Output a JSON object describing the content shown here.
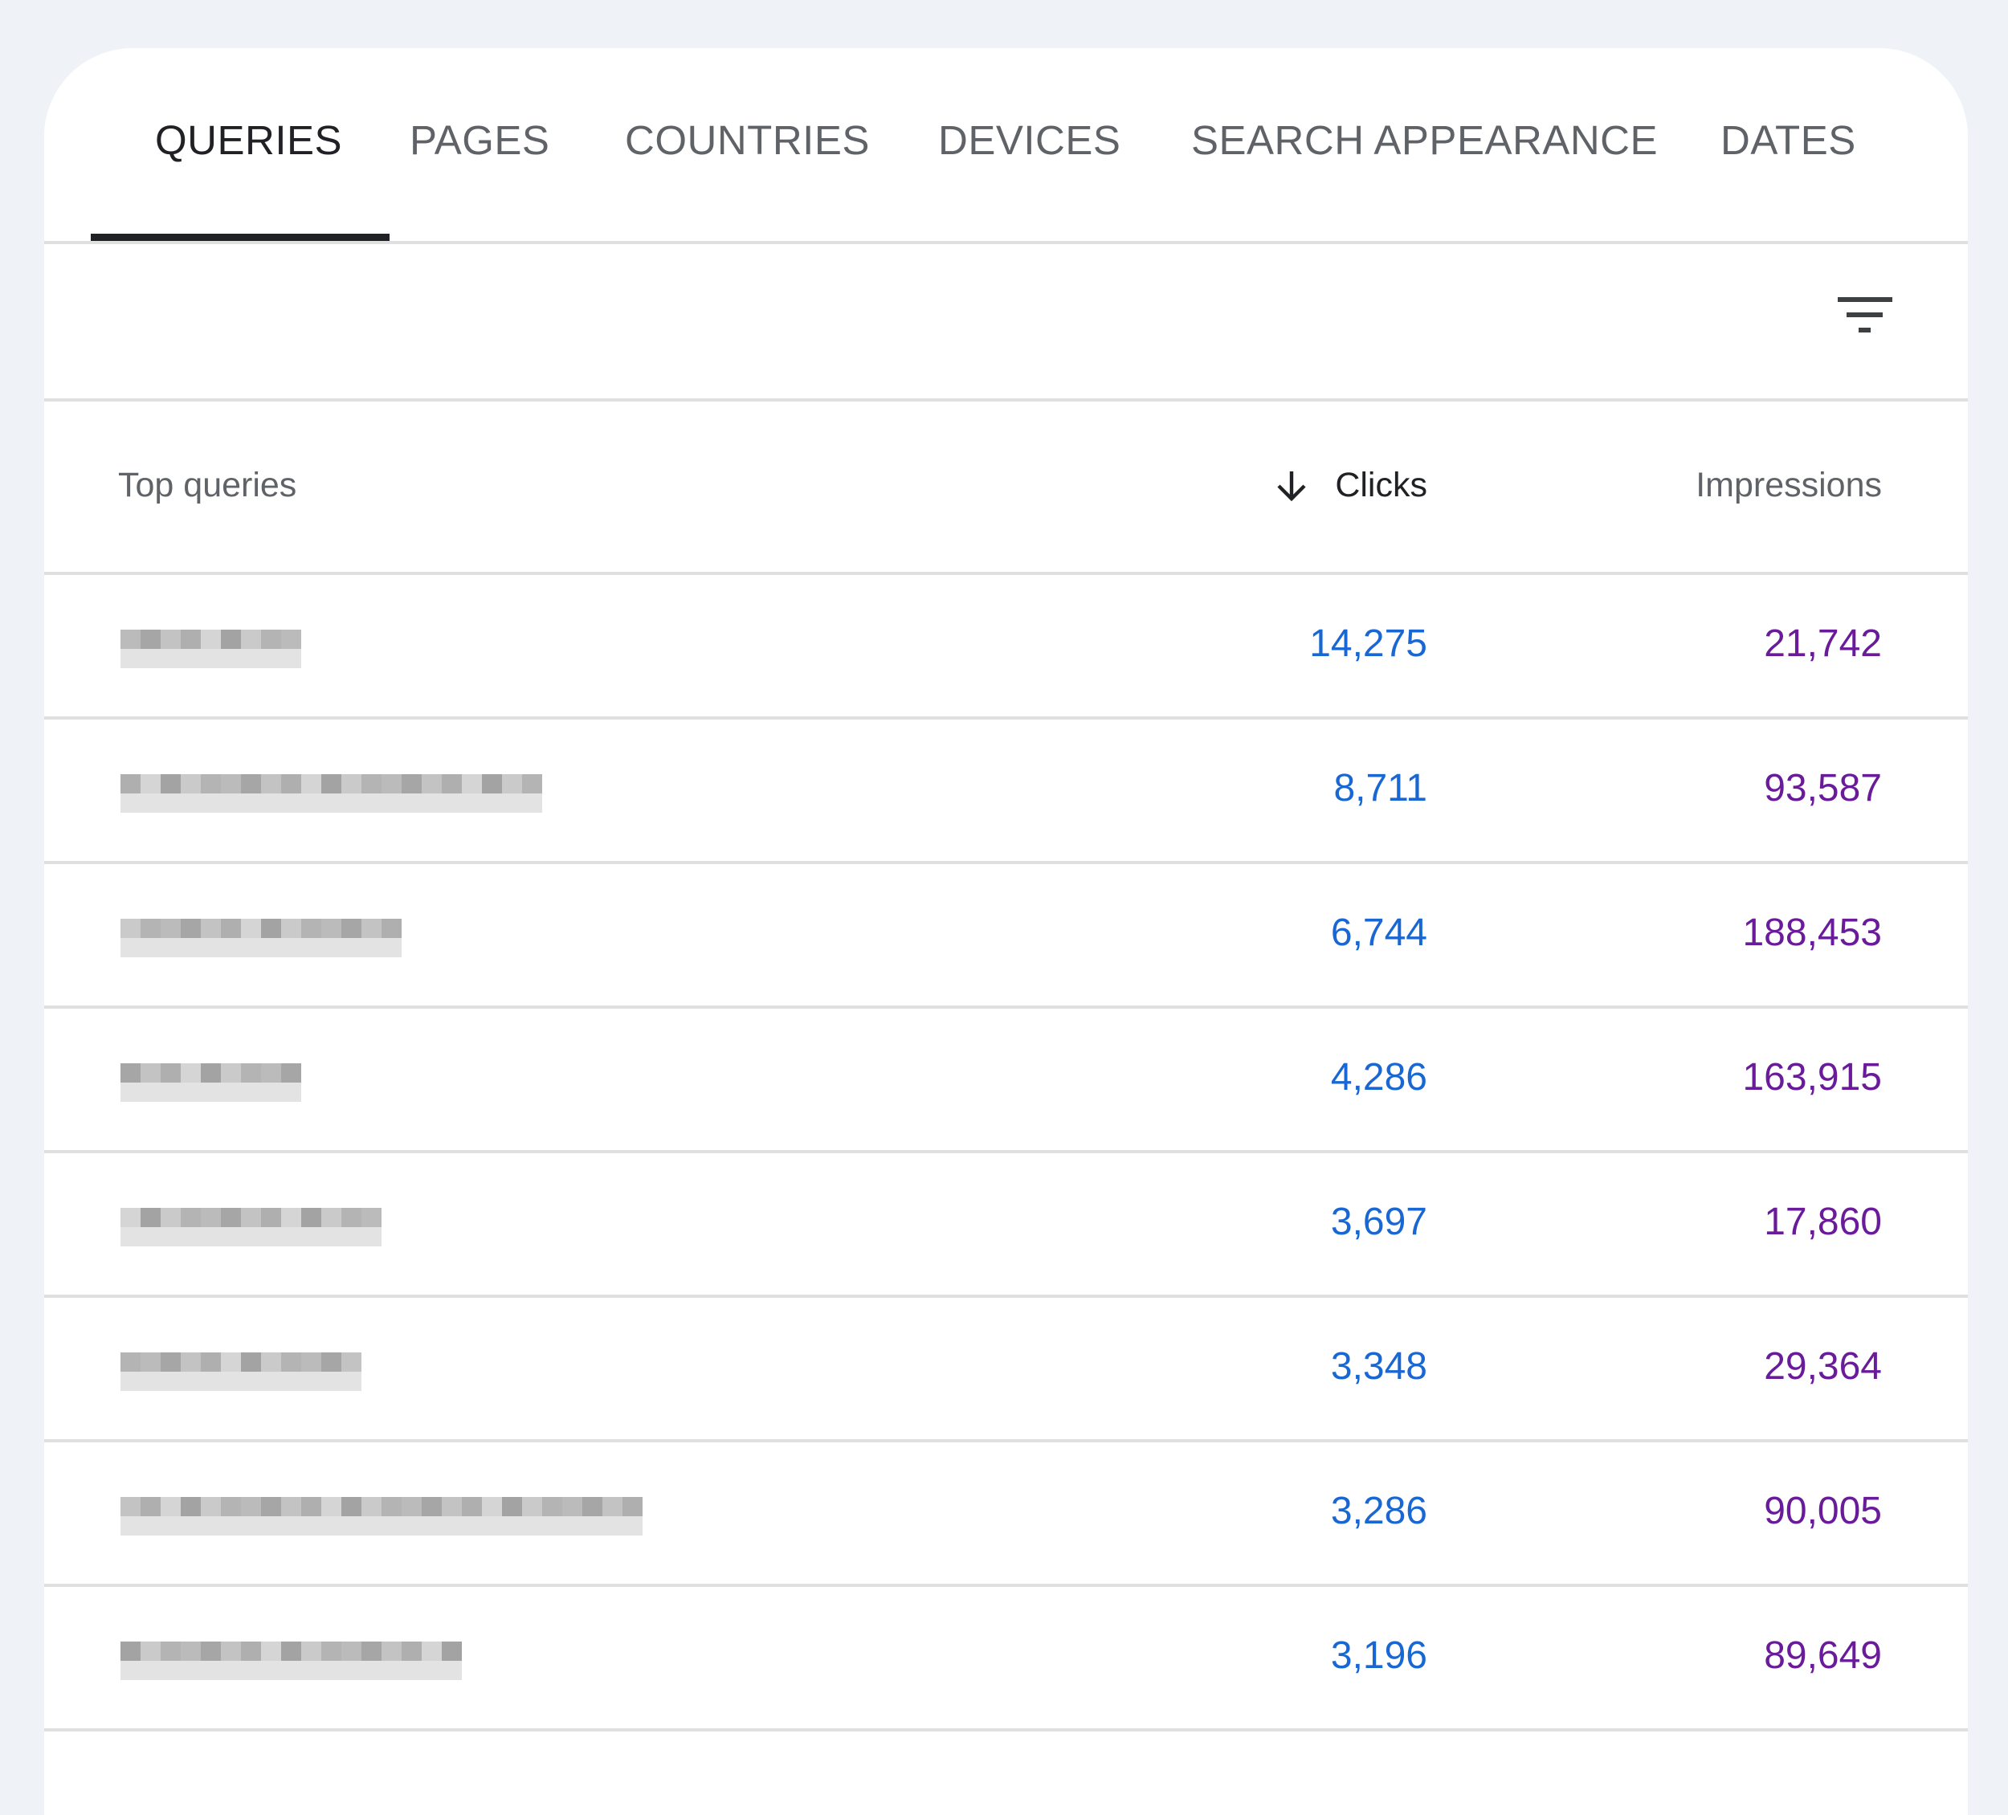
{
  "tabs": [
    {
      "label": "QUERIES",
      "active": true
    },
    {
      "label": "PAGES",
      "active": false
    },
    {
      "label": "COUNTRIES",
      "active": false
    },
    {
      "label": "DEVICES",
      "active": false
    },
    {
      "label": "SEARCH APPEARANCE",
      "active": false
    },
    {
      "label": "DATES",
      "active": false
    }
  ],
  "toolbar": {
    "filter_icon": "filter-list-icon"
  },
  "table": {
    "headers": {
      "query": "Top queries",
      "clicks": "Clicks",
      "impressions": "Impressions",
      "sort_icon": "arrow-down-icon"
    },
    "rows": [
      {
        "query": "[redacted]",
        "clicks": "14,275",
        "impressions": "21,742"
      },
      {
        "query": "[redacted]",
        "clicks": "8,711",
        "impressions": "93,587"
      },
      {
        "query": "[redacted]",
        "clicks": "6,744",
        "impressions": "188,453"
      },
      {
        "query": "[redacted]",
        "clicks": "4,286",
        "impressions": "163,915"
      },
      {
        "query": "[redacted]",
        "clicks": "3,697",
        "impressions": "17,860"
      },
      {
        "query": "[redacted]",
        "clicks": "3,348",
        "impressions": "29,364"
      },
      {
        "query": "[redacted]",
        "clicks": "3,286",
        "impressions": "90,005"
      },
      {
        "query": "[redacted]",
        "clicks": "3,196",
        "impressions": "89,649"
      }
    ]
  },
  "colors": {
    "clicks": "#1967d2",
    "impressions": "#6a1b9a",
    "active_tab": "#202124",
    "inactive_tab": "#5f6368",
    "background": "#eff3f8"
  }
}
